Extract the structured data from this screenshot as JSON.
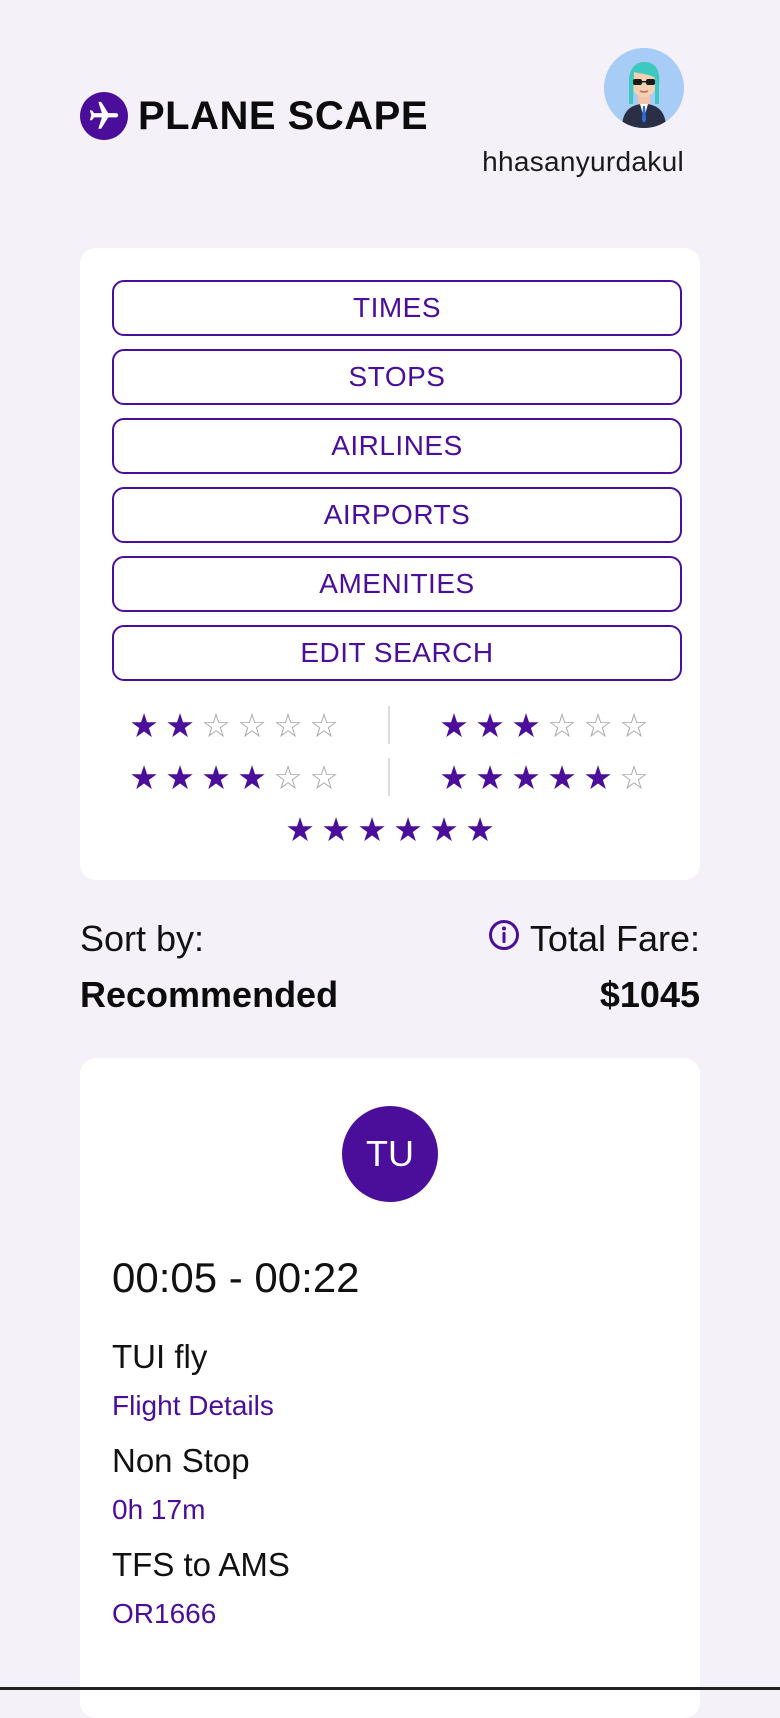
{
  "brand": {
    "name": "PLANE SCAPE",
    "icon": "plane-icon"
  },
  "user": {
    "username": "hhasanyurdakul"
  },
  "filters": {
    "buttons": [
      "TIMES",
      "STOPS",
      "AIRLINES",
      "AIRPORTS",
      "AMENITIES",
      "EDIT SEARCH"
    ],
    "star_ratings": [
      2,
      3,
      4,
      5,
      6
    ],
    "max_stars": 6
  },
  "sort": {
    "label": "Sort by:",
    "value": "Recommended"
  },
  "fare": {
    "label": "Total Fare:",
    "value": "$1045"
  },
  "flight": {
    "airline_code": "TU",
    "times": "00:05 - 00:22",
    "airline": "TUI fly",
    "details_link": "Flight Details",
    "stops": "Non Stop",
    "duration": "0h 17m",
    "route": "TFS to AMS",
    "flight_number": "OR1666"
  },
  "colors": {
    "accent": "#4a0e9a",
    "background": "#f4f2f8",
    "card": "#ffffff"
  }
}
